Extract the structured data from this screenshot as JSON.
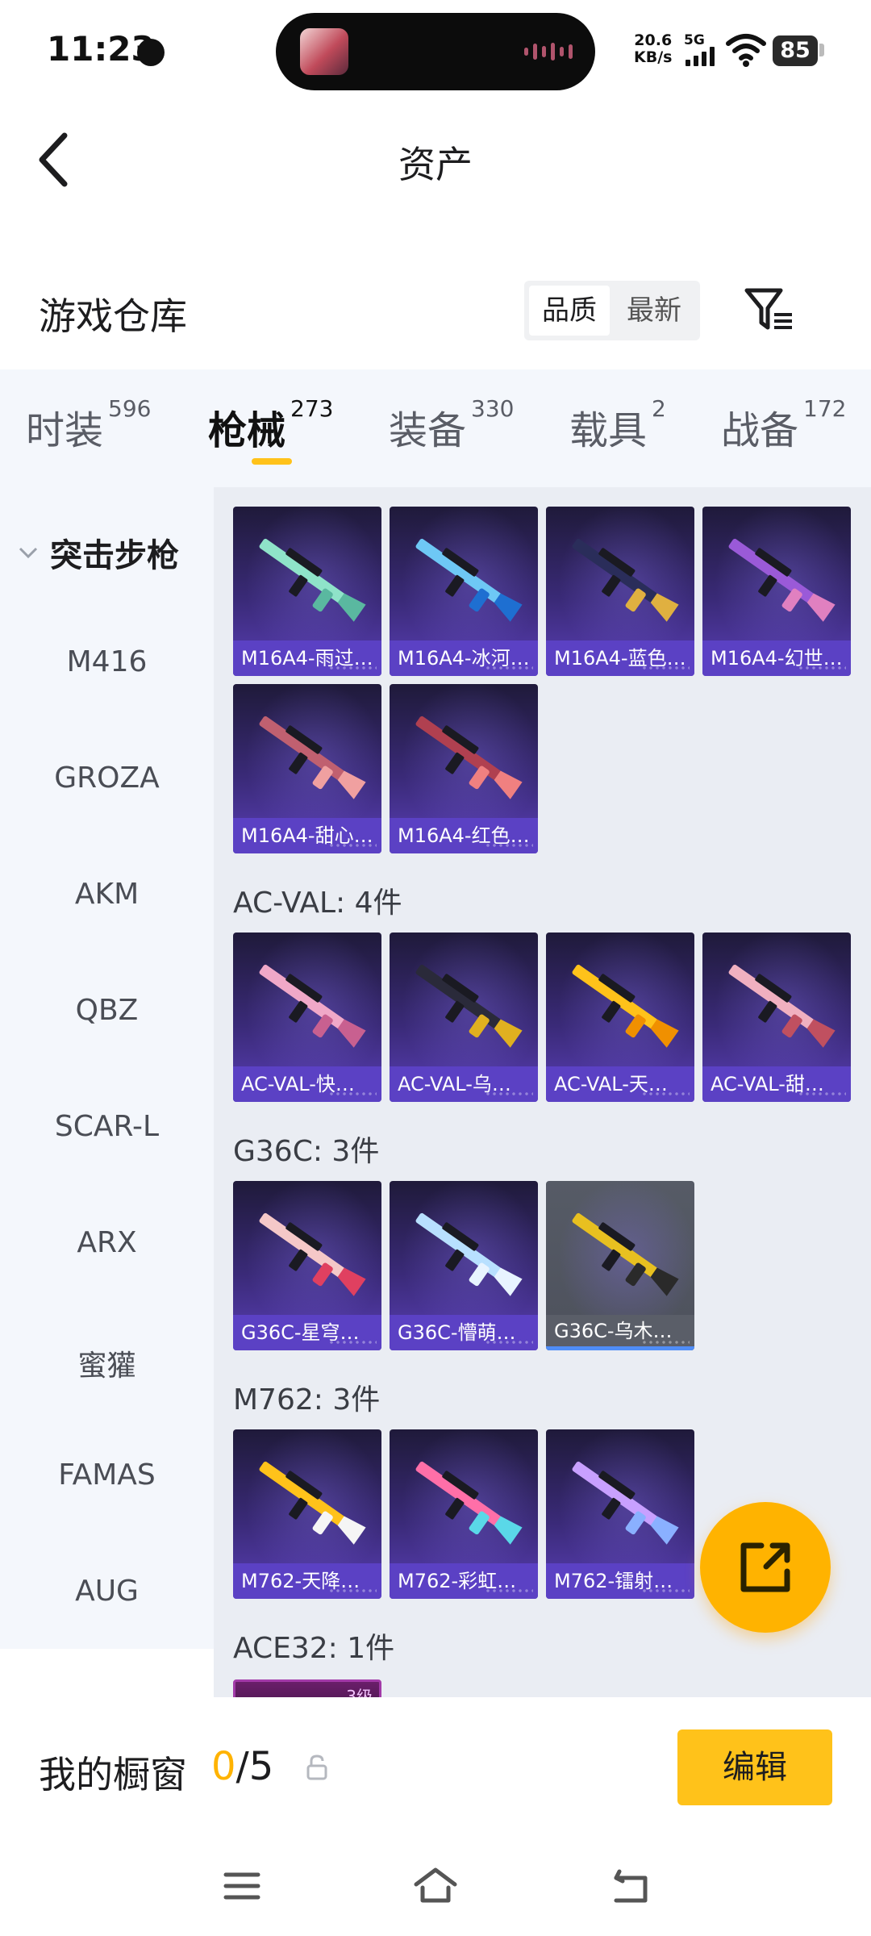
{
  "status": {
    "time": "11:23",
    "net_speed_value": "20.6",
    "net_speed_unit": "KB/s",
    "network": "5G",
    "battery": "85"
  },
  "header": {
    "title": "资产"
  },
  "warehouse": {
    "title": "游戏仓库",
    "sort_options": [
      "品质",
      "最新"
    ],
    "sort_selected": "品质"
  },
  "tabs": [
    {
      "label": "时装",
      "count": "596"
    },
    {
      "label": "枪械",
      "count": "273"
    },
    {
      "label": "装备",
      "count": "330"
    },
    {
      "label": "载具",
      "count": "2"
    },
    {
      "label": "战备",
      "count": "172"
    }
  ],
  "active_tab": "枪械",
  "sidebar": {
    "group": "突击步枪",
    "items": [
      "M416",
      "GROZA",
      "AKM",
      "QBZ",
      "SCAR-L",
      "ARX",
      "蜜獾",
      "FAMAS",
      "AUG"
    ]
  },
  "sections": [
    {
      "label": "",
      "items": [
        "M16A4-雨过…",
        "M16A4-冰河…",
        "M16A4-蓝色…",
        "M16A4-幻世…",
        "M16A4-甜心…",
        "M16A4-红色…"
      ]
    },
    {
      "label": "AC-VAL: 4件",
      "items": [
        "AC-VAL-快…",
        "AC-VAL-乌…",
        "AC-VAL-天…",
        "AC-VAL-甜…"
      ]
    },
    {
      "label": "G36C: 3件",
      "items": [
        "G36C-星穹…",
        "G36C-懵萌…",
        "G36C-乌木…"
      ]
    },
    {
      "label": "M762: 3件",
      "items": [
        "M762-天降…",
        "M762-彩虹…",
        "M762-镭射…"
      ]
    },
    {
      "label": "ACE32: 1件",
      "items": []
    }
  ],
  "ace_badge": "3级",
  "showcase": {
    "label": "我的橱窗",
    "current": "0",
    "total": "/5",
    "edit_label": "编辑"
  },
  "colors": {
    "accent": "#ffc21a",
    "card_purple": "#5b41c4",
    "sidebar_bg": "#f4f7fc"
  },
  "icons": {
    "back": "chevron-left-icon",
    "filter": "filter-icon",
    "share": "share-external-icon",
    "lock": "lock-icon",
    "nav": [
      "menu-icon",
      "home-icon",
      "back-nav-icon"
    ]
  }
}
